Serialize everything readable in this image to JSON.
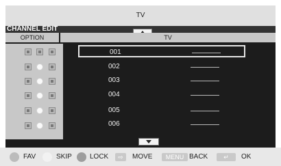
{
  "header": {
    "title": "TV"
  },
  "section": {
    "title": "CHANNEL EDIT"
  },
  "columns": {
    "option": "OPTION",
    "tv": "TV"
  },
  "channels": [
    {
      "number": "001",
      "name": "______",
      "selected": true
    },
    {
      "number": "002",
      "name": "______"
    },
    {
      "number": "003",
      "name": "______"
    },
    {
      "number": "004",
      "name": "______"
    },
    {
      "number": "005",
      "name": "______"
    },
    {
      "number": "006",
      "name": "______"
    }
  ],
  "option_icons": [
    [
      "square-icon",
      "square-icon",
      "square-icon"
    ],
    [
      "square-icon",
      "circle-icon",
      "square-icon"
    ],
    [
      "square-icon",
      "circle-icon",
      "square-icon"
    ],
    [
      "square-icon",
      "circle-icon",
      "square-icon"
    ],
    [
      "square-icon",
      "circle-icon",
      "square-icon"
    ],
    [
      "square-icon",
      "circle-icon",
      "square-icon"
    ]
  ],
  "footer": {
    "fav": "FAV",
    "skip": "SKIP",
    "lock": "LOCK",
    "move": "MOVE",
    "menu_key": "MENU",
    "back": "BACK",
    "ok": "OK"
  },
  "colors": {
    "frame": "#1c1c1c",
    "title_bar": "#e0e0e0",
    "option_panel": "#c8c8c8",
    "fav_dot": "#bcbcbc",
    "skip_dot": "#f2f2f2",
    "lock_dot": "#9e9e9e",
    "key_button": "#c9c9c9"
  }
}
